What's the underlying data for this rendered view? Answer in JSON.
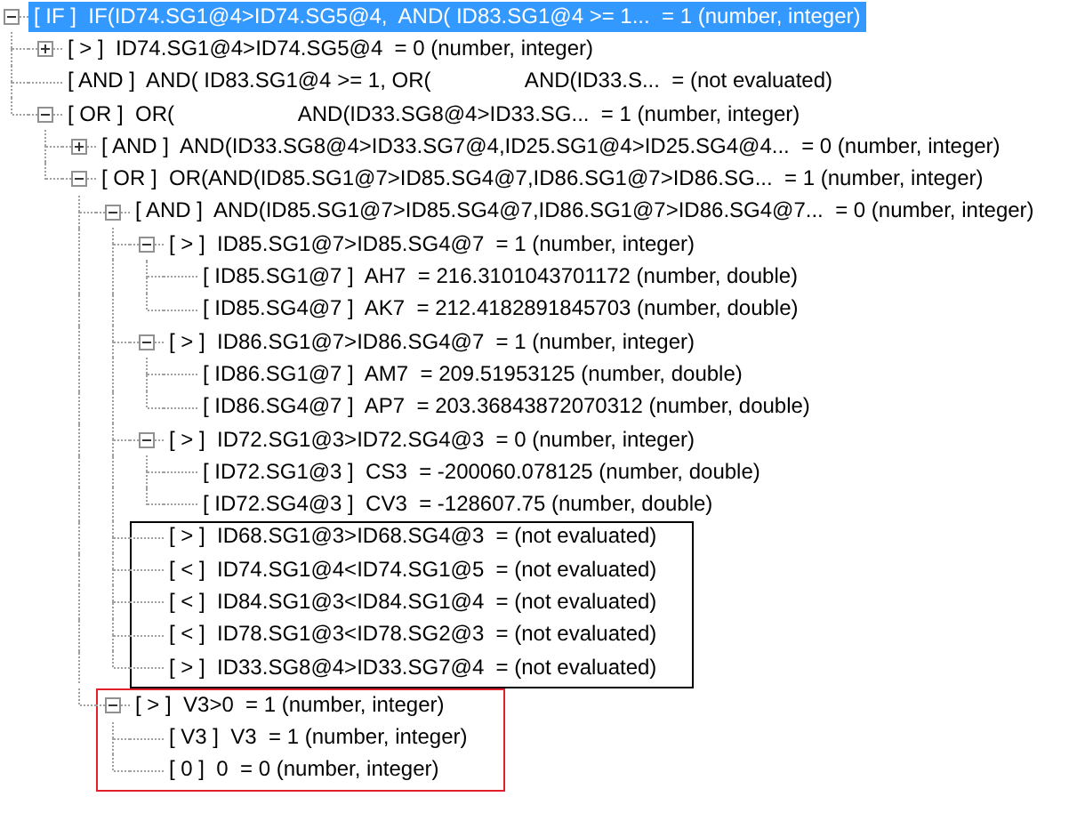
{
  "tree": {
    "label": "[ IF ]  IF(ID74.SG1@4>ID74.SG5@4,  AND( ID83.SG1@4 >= 1...  = 1 (number, integer)",
    "selected": true,
    "expanded": true,
    "children": [
      {
        "label": "[ > ]  ID74.SG1@4>ID74.SG5@4  = 0 (number, integer)",
        "selected": false,
        "expanded": false
      },
      {
        "label": "[ AND ]  AND( ID83.SG1@4 >= 1, OR(                AND(ID33.S...  = (not evaluated)",
        "selected": false
      },
      {
        "label": "[ OR ]  OR(                     AND(ID33.SG8@4>ID33.SG...  = 1 (number, integer)",
        "selected": false,
        "expanded": true,
        "children": [
          {
            "label": "[ AND ]  AND(ID33.SG8@4>ID33.SG7@4,ID25.SG1@4>ID25.SG4@4...  = 0 (number, integer)",
            "selected": false,
            "expanded": false
          },
          {
            "label": "[ OR ]  OR(AND(ID85.SG1@7>ID85.SG4@7,ID86.SG1@7>ID86.SG...  = 1 (number, integer)",
            "selected": false,
            "expanded": true,
            "children": [
              {
                "label": "[ AND ]  AND(ID85.SG1@7>ID85.SG4@7,ID86.SG1@7>ID86.SG4@7...  = 0 (number, integer)",
                "selected": false,
                "expanded": true,
                "children": [
                  {
                    "label": "[ > ]  ID85.SG1@7>ID85.SG4@7  = 1 (number, integer)",
                    "selected": false,
                    "expanded": true,
                    "children": [
                      {
                        "label": "[ ID85.SG1@7 ]  AH7  = 216.3101043701172 (number, double)",
                        "selected": false
                      },
                      {
                        "label": "[ ID85.SG4@7 ]  AK7  = 212.4182891845703 (number, double)",
                        "selected": false
                      }
                    ]
                  },
                  {
                    "label": "[ > ]  ID86.SG1@7>ID86.SG4@7  = 1 (number, integer)",
                    "selected": false,
                    "expanded": true,
                    "children": [
                      {
                        "label": "[ ID86.SG1@7 ]  AM7  = 209.51953125 (number, double)",
                        "selected": false
                      },
                      {
                        "label": "[ ID86.SG4@7 ]  AP7  = 203.36843872070312 (number, double)",
                        "selected": false
                      }
                    ]
                  },
                  {
                    "label": "[ > ]  ID72.SG1@3>ID72.SG4@3  = 0 (number, integer)",
                    "selected": false,
                    "expanded": true,
                    "children": [
                      {
                        "label": "[ ID72.SG1@3 ]  CS3  = -200060.078125 (number, double)",
                        "selected": false
                      },
                      {
                        "label": "[ ID72.SG4@3 ]  CV3  = -128607.75 (number, double)",
                        "selected": false
                      }
                    ]
                  },
                  {
                    "label": "[ > ]  ID68.SG1@3>ID68.SG4@3  = (not evaluated)",
                    "selected": false,
                    "color": "#000000"
                  },
                  {
                    "label": "[ < ]  ID74.SG1@4<ID74.SG1@5  = (not evaluated)",
                    "selected": false,
                    "color": "#000000"
                  },
                  {
                    "label": "[ < ]  ID84.SG1@3<ID84.SG1@4  = (not evaluated)",
                    "selected": false,
                    "color": "#000000"
                  },
                  {
                    "label": "[ < ]  ID78.SG1@3<ID78.SG2@3  = (not evaluated)",
                    "selected": false,
                    "color": "#000000"
                  },
                  {
                    "label": "[ > ]  ID33.SG8@4>ID33.SG7@4  = (not evaluated)",
                    "selected": false,
                    "color": "#000000"
                  }
                ]
              },
              {
                "label": "[ > ]  V3>0  = 1 (number, integer)",
                "selected": false,
                "expanded": true,
                "color": "#e0202a",
                "children": [
                  {
                    "label": "[ V3 ]  V3  = 1 (number, integer)",
                    "selected": false
                  },
                  {
                    "label": "[ 0 ]  0  = 0 (number, integer)",
                    "selected": false
                  }
                ]
              }
            ]
          }
        ]
      }
    ]
  }
}
